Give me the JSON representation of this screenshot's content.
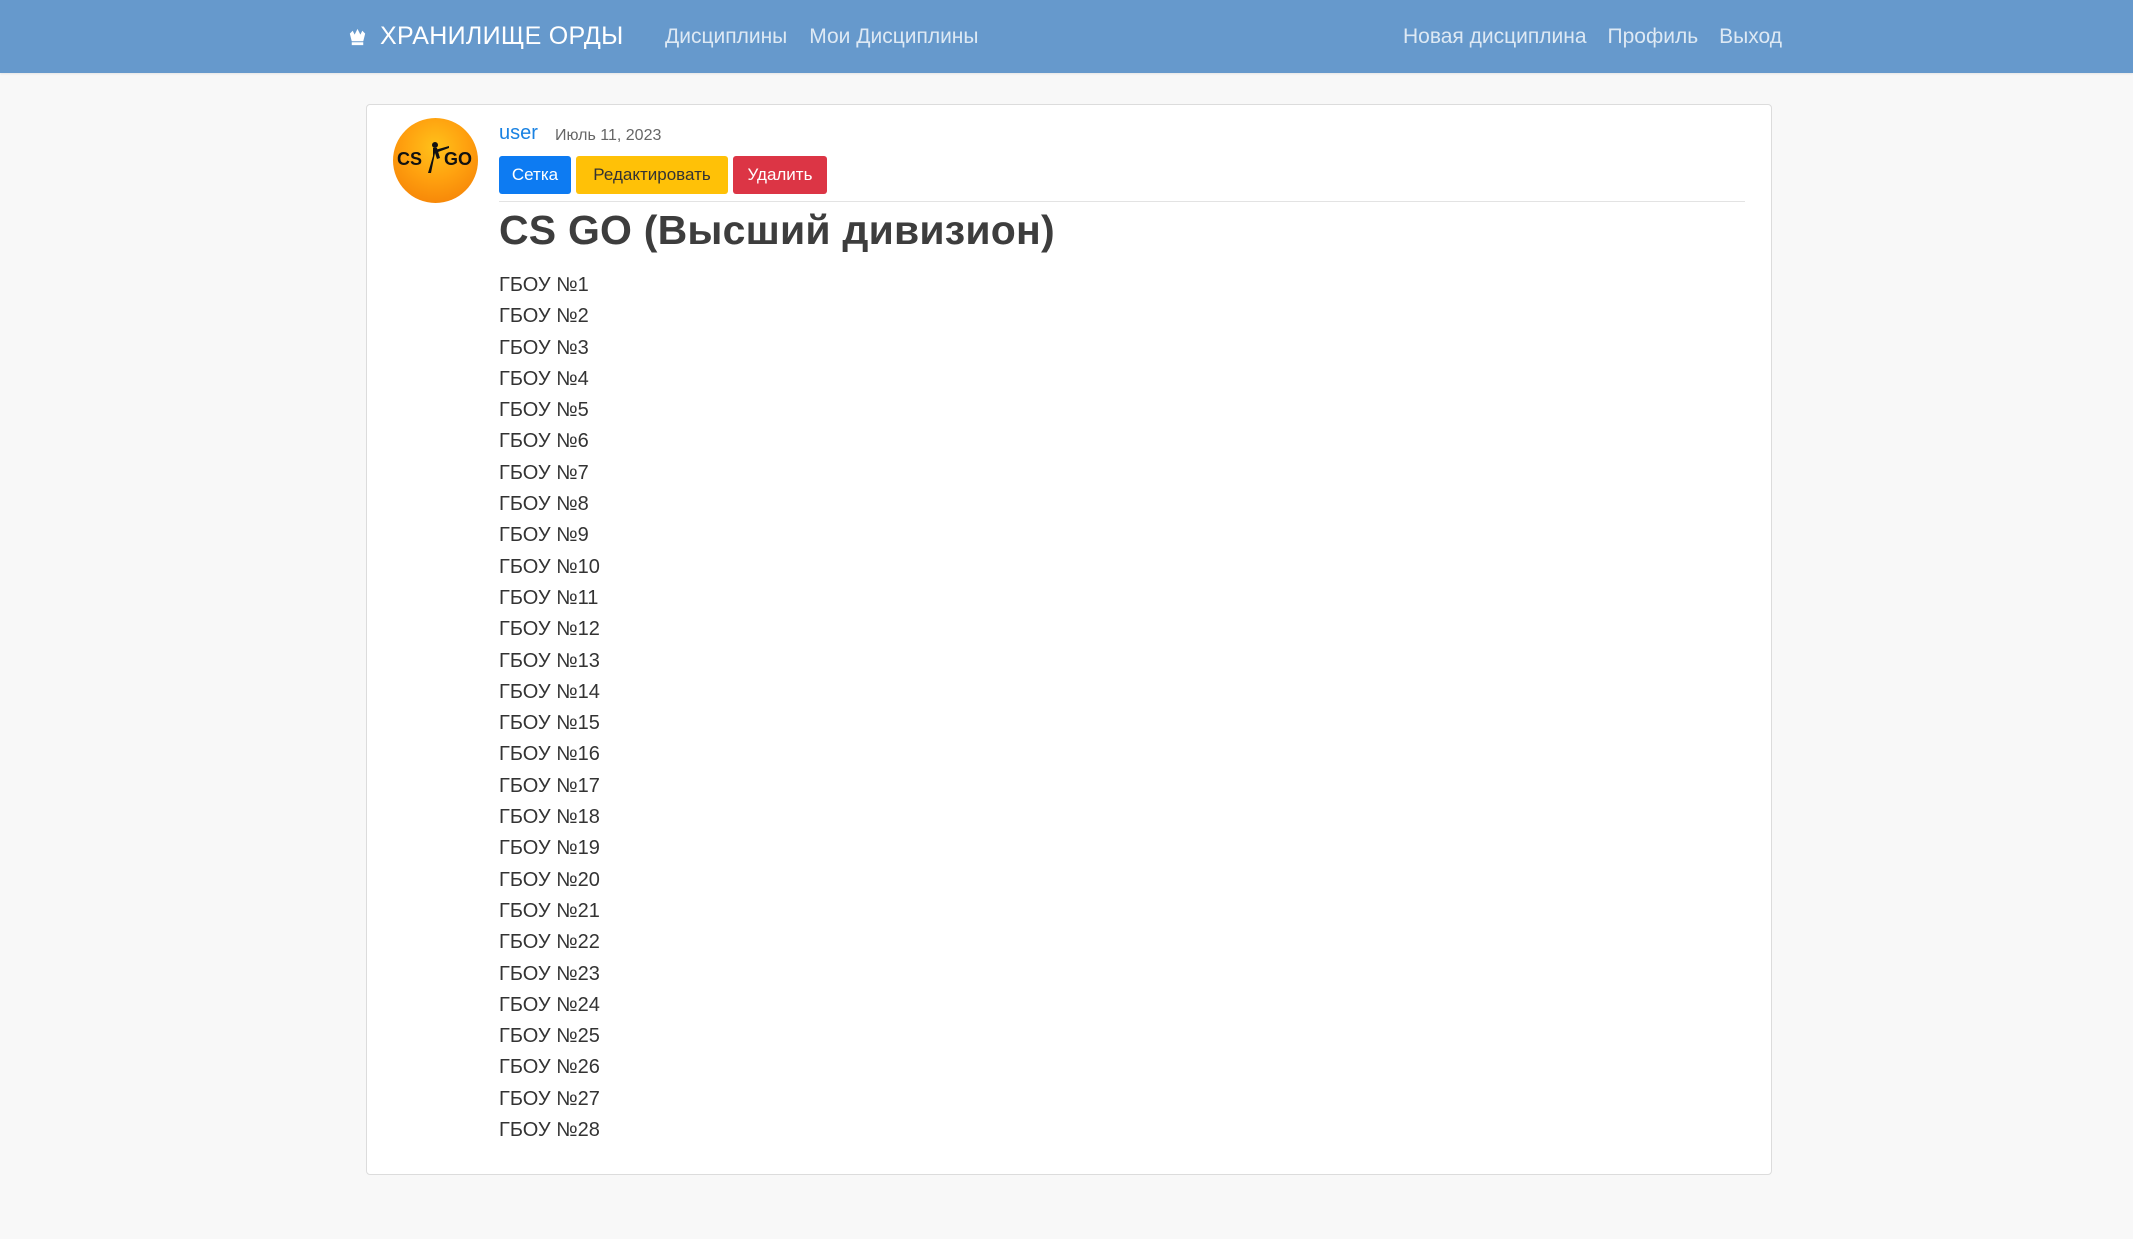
{
  "navbar": {
    "brand": "ХРАНИЛИЩЕ ОРДЫ",
    "left_links": [
      "Дисциплины",
      "Мои Дисциплины"
    ],
    "right_links": [
      "Новая дисциплина",
      "Профиль",
      "Выход"
    ]
  },
  "post": {
    "avatar_text": "CSGO",
    "author": "user",
    "date": "Июль 11, 2023",
    "buttons": {
      "grid": "Сетка",
      "edit": "Редактировать",
      "delete": "Удалить"
    },
    "title": "CS GO (Высший дивизион)",
    "teams": [
      "ГБОУ №1",
      "ГБОУ №2",
      "ГБОУ №3",
      "ГБОУ №4",
      "ГБОУ №5",
      "ГБОУ №6",
      "ГБОУ №7",
      "ГБОУ №8",
      "ГБОУ №9",
      "ГБОУ №10",
      "ГБОУ №11",
      "ГБОУ №12",
      "ГБОУ №13",
      "ГБОУ №14",
      "ГБОУ №15",
      "ГБОУ №16",
      "ГБОУ №17",
      "ГБОУ №18",
      "ГБОУ №19",
      "ГБОУ №20",
      "ГБОУ №21",
      "ГБОУ №22",
      "ГБОУ №23",
      "ГБОУ №24",
      "ГБОУ №25",
      "ГБОУ №26",
      "ГБОУ №27",
      "ГБОУ №28"
    ]
  },
  "colors": {
    "navbar_bg": "#6699cc",
    "page_bg": "#f8f8f8",
    "link": "#1a82e2",
    "btn_primary": "#0d7bf2",
    "btn_warning": "#ffc107",
    "btn_danger": "#dc3545"
  },
  "icons": {
    "brand": "crown-icon",
    "avatar": "csgo-logo"
  }
}
